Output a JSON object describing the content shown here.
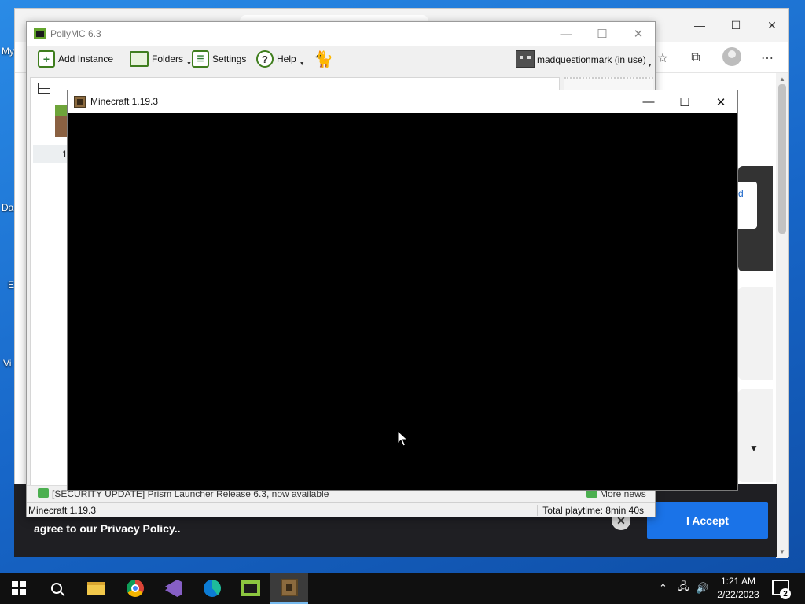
{
  "desktop": {
    "icons": [
      {
        "label": "My",
        "name": "desktop-icon-my"
      },
      {
        "label": "Da",
        "name": "desktop-icon-da"
      },
      {
        "label": "E",
        "name": "desktop-icon-e"
      },
      {
        "label": "Vi",
        "name": "desktop-icon-vi"
      }
    ]
  },
  "browser": {
    "right_link_fragment": "d",
    "cookie_banner": {
      "text": "agree to our Privacy Policy..",
      "accept_label": "I Accept",
      "close_symbol": "✕"
    }
  },
  "pollymc": {
    "title": "PollyMC 6.3",
    "toolbar": {
      "add_instance": "Add Instance",
      "folders": "Folders",
      "settings": "Settings",
      "help": "Help",
      "account": "madquestionmark (in use)"
    },
    "instance_label": "1.",
    "news": "[SECURITY UPDATE] Prism Launcher Release 6.3, now available",
    "more_news": "More news",
    "status_instance": "Minecraft 1.19.3",
    "total_playtime": "Total playtime: 8min 40s"
  },
  "minecraft_window": {
    "title": "Minecraft 1.19.3"
  },
  "taskbar": {
    "time": "1:21 AM",
    "date": "2/22/2023",
    "notification_count": "2",
    "apps": [
      "start",
      "search",
      "file-explorer",
      "chrome",
      "visual-studio",
      "edge",
      "pollymc",
      "minecraft"
    ],
    "active_app": "minecraft"
  },
  "colors": {
    "desktop": "#1766c8",
    "accept_button": "#1a73e8",
    "cookie_banner": "#1f1f23",
    "taskbar": "#101010",
    "polly_accent": "#3f7e1e"
  }
}
